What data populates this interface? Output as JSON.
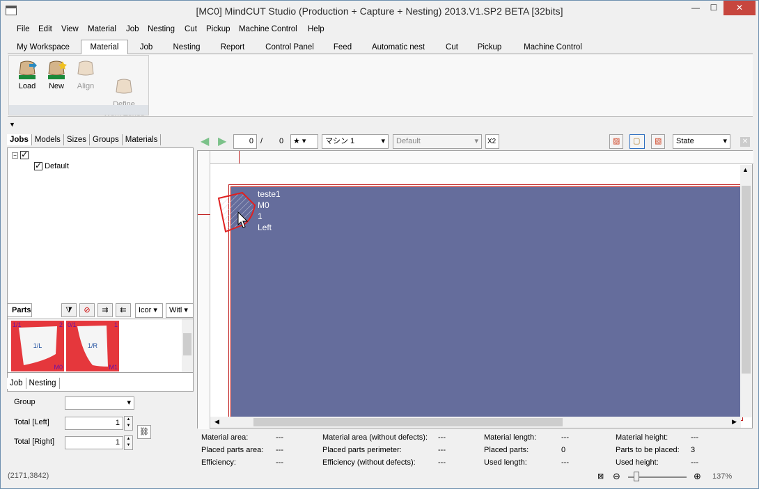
{
  "window": {
    "title": "[MC0] MindCUT Studio (Production + Capture + Nesting) 2013.V1.SP2  BETA [32bits]",
    "controls": {
      "minimize": "—",
      "maximize": "☐",
      "close": "✕"
    }
  },
  "menubar": [
    "File",
    "Edit",
    "View",
    "Material",
    "Job",
    "Nesting",
    "Cut",
    "Pickup",
    "Machine Control",
    "Help"
  ],
  "ribbon_tabs": [
    "My Workspace",
    "Material",
    "Job",
    "Nesting",
    "Report",
    "Control Panel",
    "Feed",
    "Automatic nest",
    "Cut",
    "Pickup",
    "Machine Control"
  ],
  "active_ribbon_tab": "Material",
  "ribbon_buttons": [
    {
      "label": "Load",
      "enabled": true
    },
    {
      "label": "New",
      "enabled": true
    },
    {
      "label": "Align",
      "enabled": false
    },
    {
      "label": "Define\nWork Zones",
      "enabled": false
    }
  ],
  "left_tabs": [
    "Jobs",
    "Models",
    "Sizes",
    "Groups",
    "Materials"
  ],
  "tree": {
    "root_checked": true,
    "child": "Default",
    "child_checked": true
  },
  "parts": {
    "label": "Parts",
    "view_select": "Icor",
    "width_select": "Witl",
    "items": [
      {
        "tl": "1/1",
        "tr": "2",
        "center": "1/L",
        "br": "M0"
      },
      {
        "tl": "0/1",
        "tr": "1",
        "center": "1/R",
        "br": "M1"
      }
    ]
  },
  "bottom_tabs": [
    "Job",
    "Nesting"
  ],
  "job_form": {
    "group_label": "Group",
    "group_value": "",
    "total_left_label": "Total [Left]",
    "total_left": "1",
    "total_right_label": "Total [Right]",
    "total_right": "1"
  },
  "canvas_toolbar": {
    "page": "0",
    "separator": "/",
    "total": "0",
    "machine": "マシン 1",
    "profile": "Default",
    "x2": "X2",
    "state": "State"
  },
  "material_labels": [
    "teste1",
    "M0",
    "1",
    "Left"
  ],
  "info": {
    "material_area": {
      "label": "Material area:",
      "value": "---"
    },
    "placed_parts_area": {
      "label": "Placed parts area:",
      "value": "---"
    },
    "efficiency": {
      "label": "Efficiency:",
      "value": "---"
    },
    "material_area_wo": {
      "label": "Material area (without defects):",
      "value": "---"
    },
    "placed_parts_perimeter": {
      "label": "Placed parts perimeter:",
      "value": "---"
    },
    "efficiency_wo": {
      "label": "Efficiency (without defects):",
      "value": "---"
    },
    "material_length": {
      "label": "Material length:",
      "value": "---"
    },
    "placed_parts": {
      "label": "Placed parts:",
      "value": "0"
    },
    "used_length": {
      "label": "Used length:",
      "value": "---"
    },
    "material_height": {
      "label": "Material height:",
      "value": "---"
    },
    "parts_to_be_placed": {
      "label": "Parts to be placed:",
      "value": "3"
    },
    "used_height": {
      "label": "Used height:",
      "value": "---"
    }
  },
  "status": {
    "coords": "(2171,3842)",
    "zoom": "137%"
  }
}
